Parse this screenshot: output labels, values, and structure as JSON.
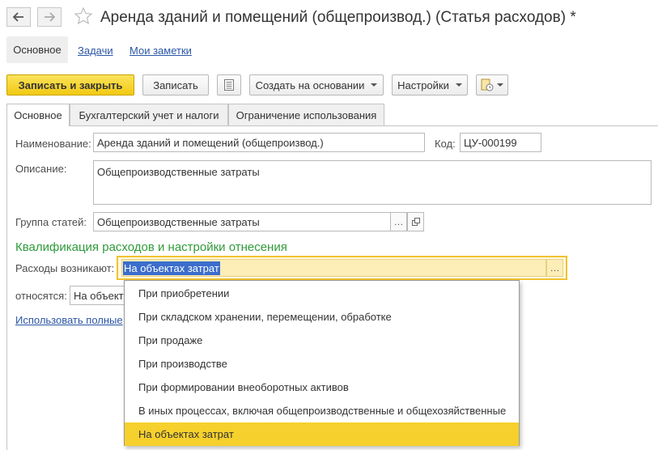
{
  "window": {
    "title": "Аренда зданий и помещений (общепроизвод.) (Статья расходов) *"
  },
  "sections": {
    "main": "Основное",
    "tasks": "Задачи",
    "notes": "Мои заметки"
  },
  "toolbar": {
    "save_close": "Записать и закрыть",
    "save": "Записать",
    "create_based": "Создать на основании",
    "settings": "Настройки"
  },
  "tabs": [
    "Основное",
    "Бухгалтерский учет и налоги",
    "Ограничение использования"
  ],
  "form": {
    "name_label": "Наименование:",
    "name_value": "Аренда зданий и помещений (общепроизвод.)",
    "code_label": "Код:",
    "code_value": "ЦУ-000199",
    "description_label": "Описание:",
    "description_value": "Общепроизводственные затраты",
    "group_label": "Группа статей:",
    "group_value": "Общепроизводственные затраты",
    "section_title": "Квалификация расходов и настройки отнесения",
    "expenses_label": "Расходы возникают:",
    "expenses_value": "На объектах затрат",
    "relate_label": "относятся:",
    "relate_value": "На объект",
    "full_list_link": "Использовать полные"
  },
  "dropdown": {
    "items": [
      "При приобретении",
      "При складском хранении, перемещении, обработке",
      "При продаже",
      "При производстве",
      "При формировании внеоборотных активов",
      "В иных процессах, включая общепроизводственные и общехозяйственные",
      "На объектах затрат"
    ],
    "selected_index": 6
  },
  "colors": {
    "accent_yellow": "#f2c912",
    "selection_blue": "#3b6dcc",
    "section_green": "#2f9b3a",
    "link_blue": "#2b56a5"
  }
}
